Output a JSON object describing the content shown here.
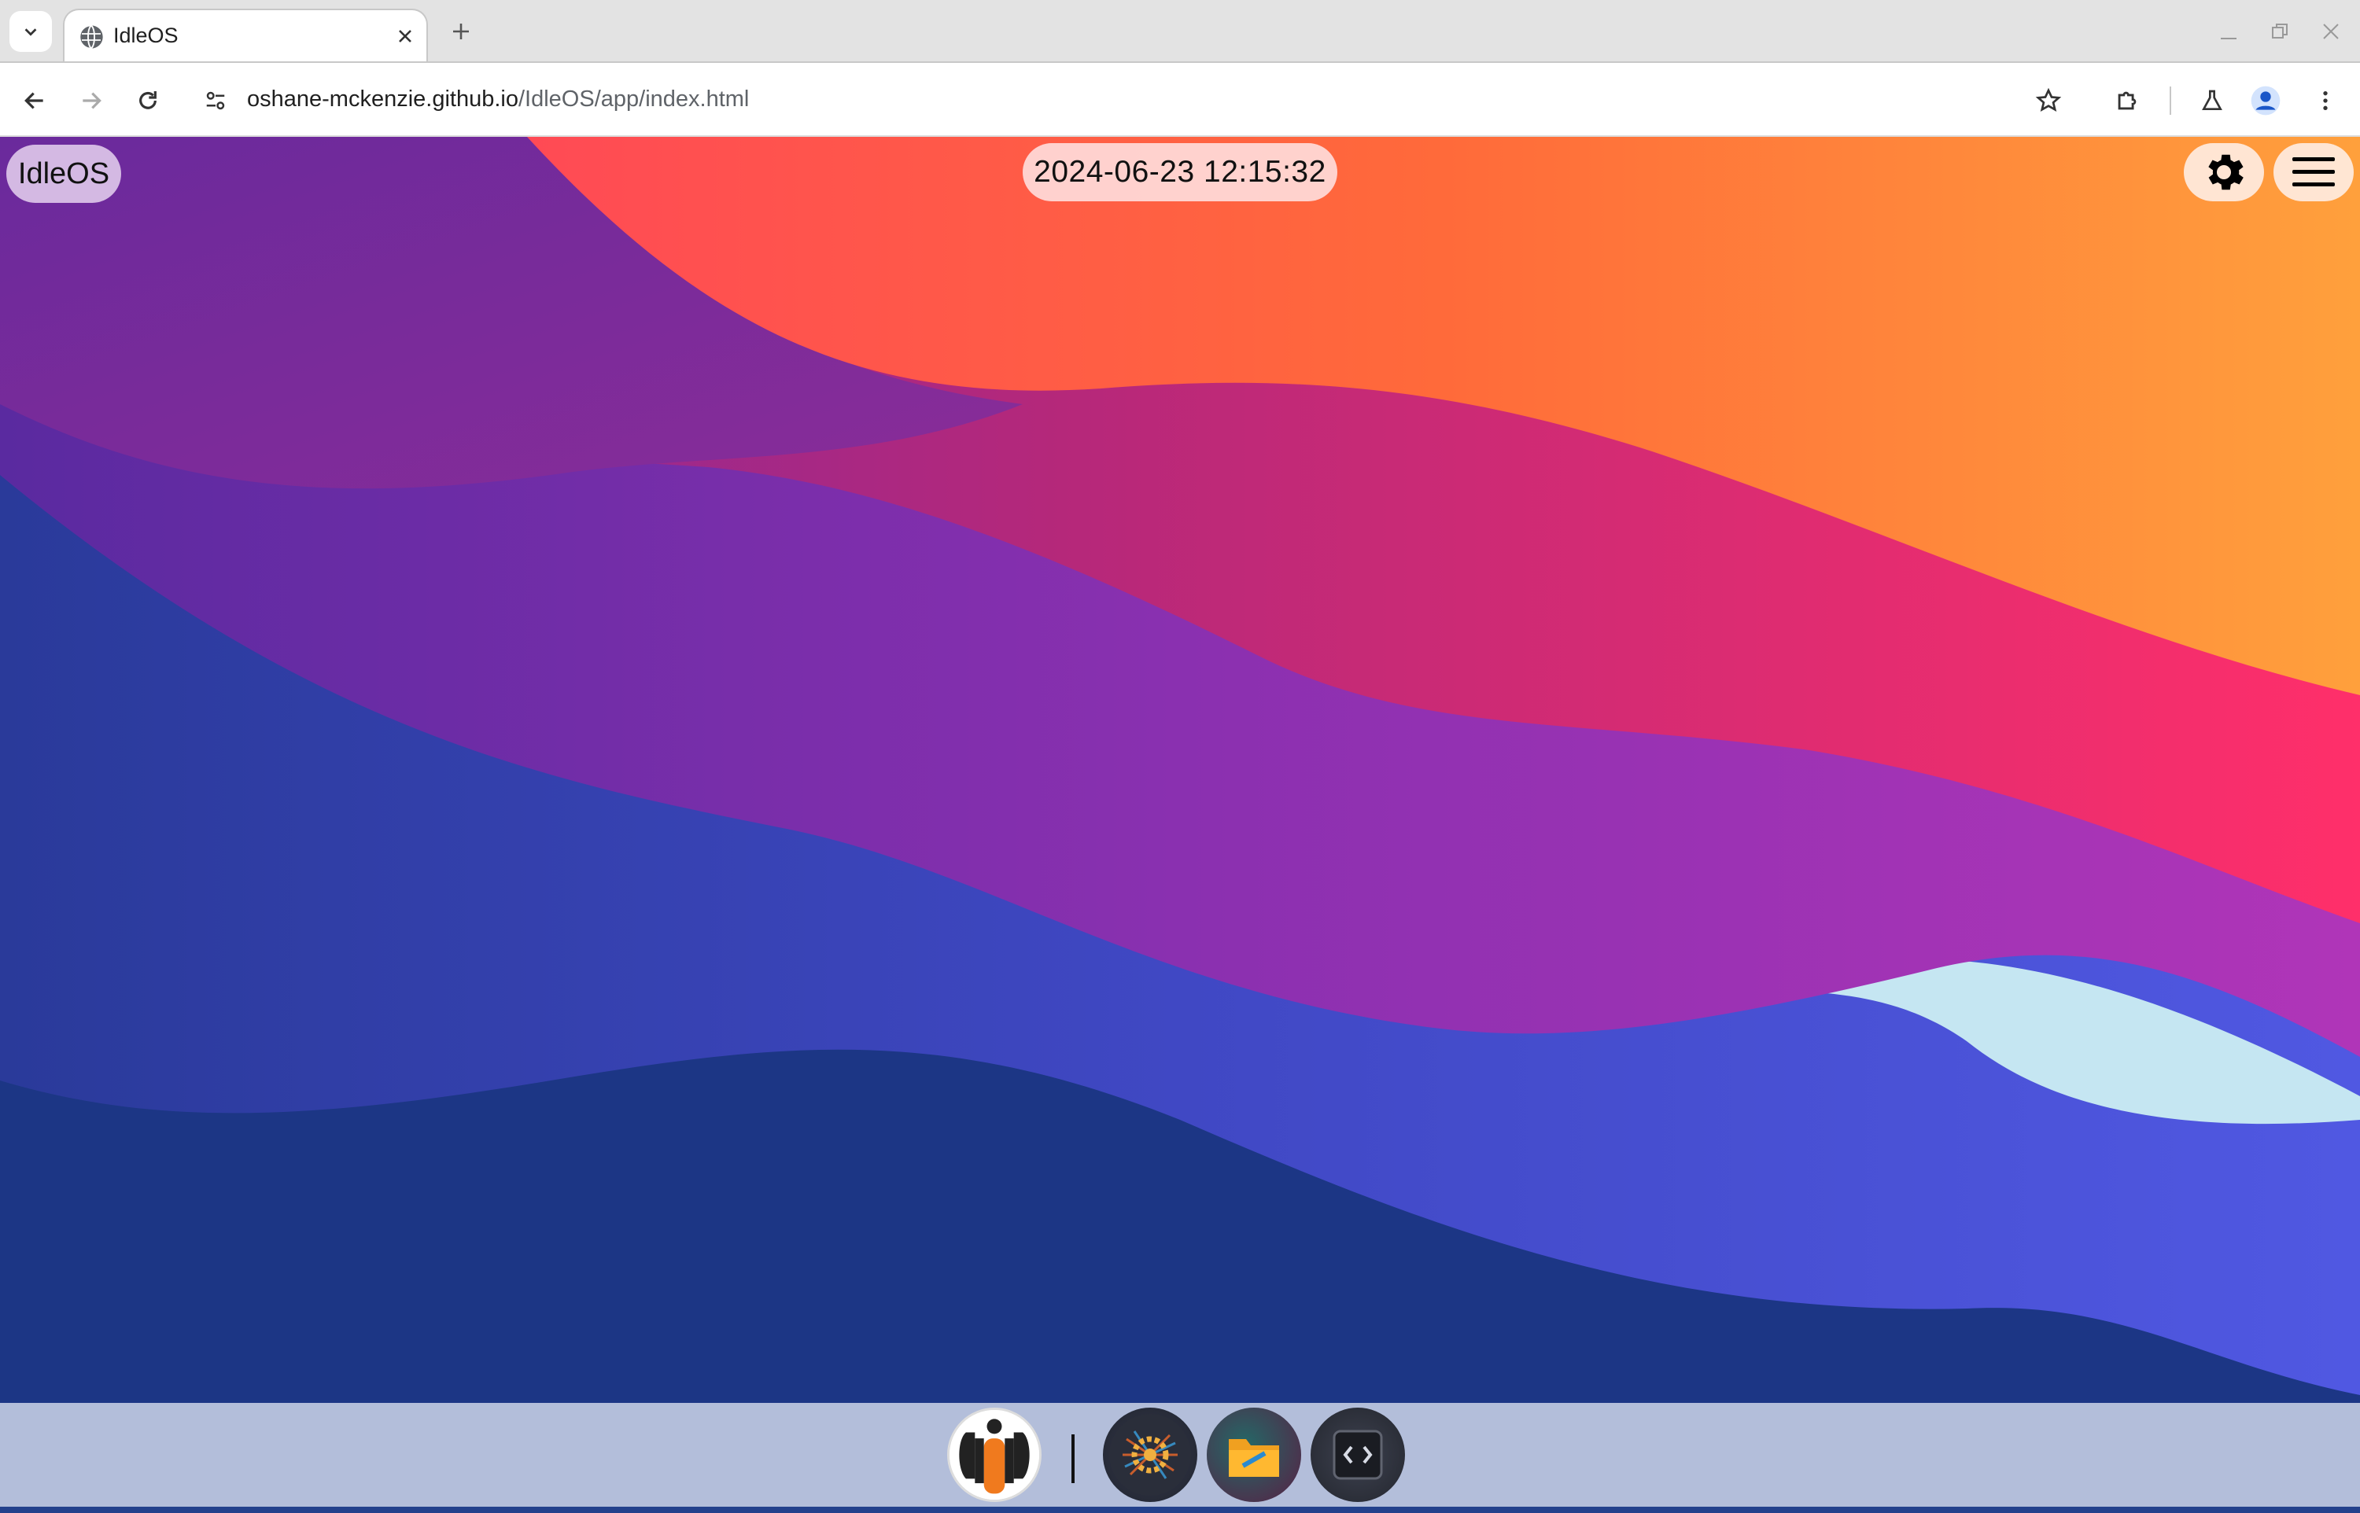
{
  "browser": {
    "tab": {
      "title": "IdleOS"
    },
    "url": {
      "host": "oshane-mckenzie.github.io",
      "path": "/IdleOS/app/index.html"
    }
  },
  "desktop": {
    "logo_label": "IdleOS",
    "clock_text": "2024-06-23 12:15:32",
    "top_right_icons": [
      "gear-icon",
      "hamburger-menu-icon"
    ],
    "dock": {
      "apps": [
        {
          "name": "idleos-launcher",
          "icon": "idleos-logo-icon"
        },
        {
          "name": "settings-app",
          "icon": "settings-gear-app-icon"
        },
        {
          "name": "file-manager-app",
          "icon": "folder-app-icon"
        },
        {
          "name": "code-editor-app",
          "icon": "code-brackets-app-icon"
        }
      ]
    }
  },
  "colors": {
    "wave_orange": "#ff9a3c",
    "wave_red": "#ff4f55",
    "wave_pink": "#e32a72",
    "wave_purple": "#8a2fb0",
    "wave_violet": "#4a4fd6",
    "wave_navy": "#1c3685",
    "wave_light": "#c5e6f2"
  }
}
